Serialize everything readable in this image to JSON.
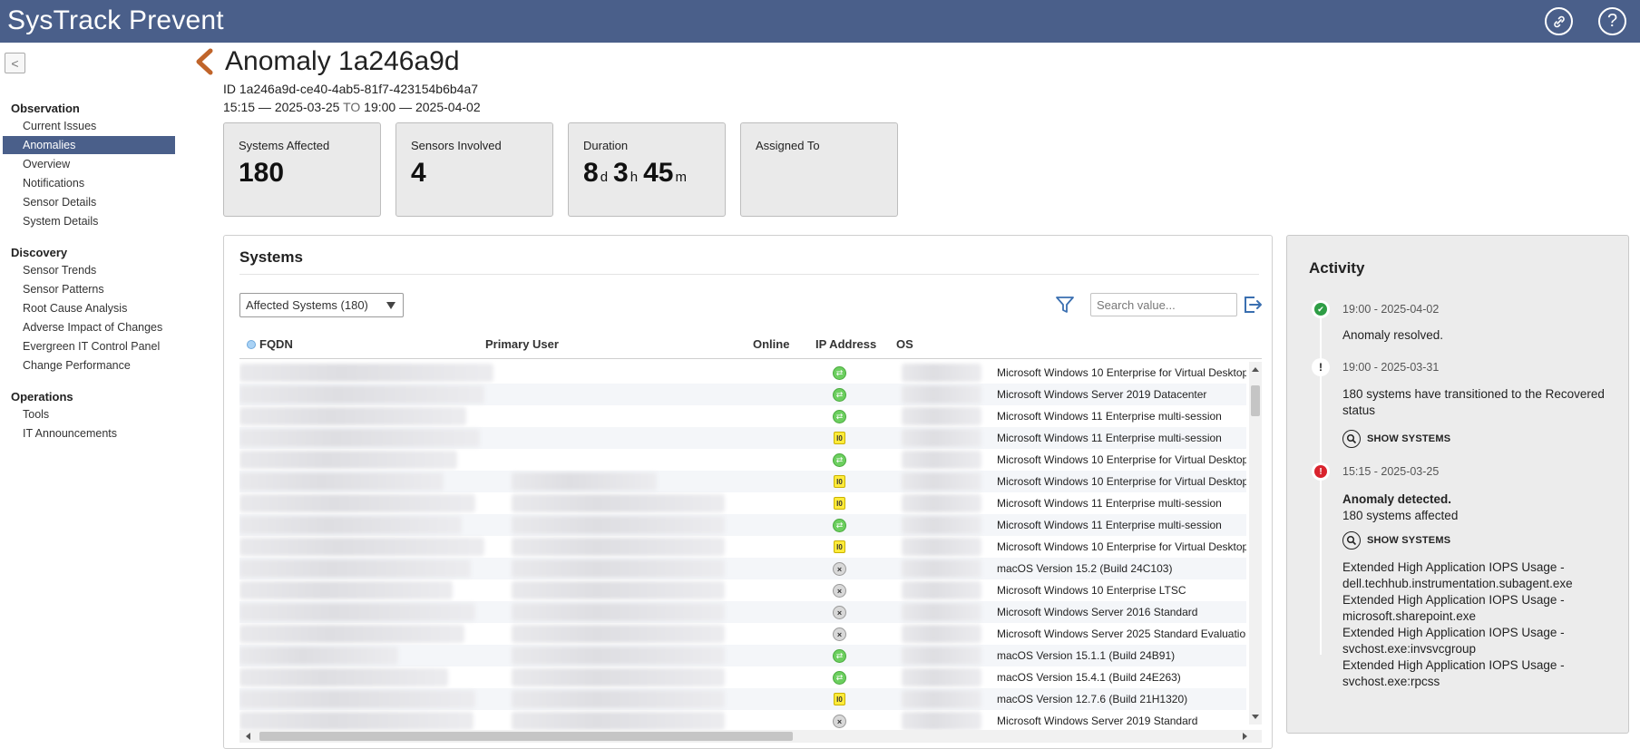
{
  "header": {
    "app_title": "SysTrack Prevent",
    "link_icon": "link-icon",
    "help_label": "?"
  },
  "sidebar": {
    "collapse_glyph": "<",
    "sections": [
      {
        "title": "Observation",
        "items": [
          "Current Issues",
          "Anomalies",
          "Overview",
          "Notifications",
          "Sensor Details",
          "System Details"
        ]
      },
      {
        "title": "Discovery",
        "items": [
          "Sensor Trends",
          "Sensor Patterns",
          "Root Cause Analysis",
          "Adverse Impact of Changes",
          "Evergreen IT Control Panel",
          "Change Performance"
        ]
      },
      {
        "title": "Operations",
        "items": [
          "Tools",
          "IT Announcements"
        ]
      }
    ],
    "active_item": "Anomalies"
  },
  "anomaly": {
    "title": "Anomaly 1a246a9d",
    "id_text": "ID 1a246a9d-ce40-4ab5-81f7-423154b6b4a7",
    "start": "15:15 — 2025-03-25",
    "to_label": "TO",
    "end": "19:00 — 2025-04-02"
  },
  "cards": {
    "systems_affected": {
      "label": "Systems Affected",
      "value": "180"
    },
    "sensors_involved": {
      "label": "Sensors Involved",
      "value": "4"
    },
    "duration": {
      "label": "Duration",
      "days": "8",
      "days_unit": "d",
      "hours": "3",
      "hours_unit": "h",
      "minutes": "45",
      "minutes_unit": "m"
    },
    "assigned_to": {
      "label": "Assigned To",
      "value": ""
    }
  },
  "systems": {
    "title": "Systems",
    "filter_select": "Affected Systems (180)",
    "search_placeholder": "Search value...",
    "columns": {
      "fqdn": "FQDN",
      "primary_user": "Primary User",
      "online": "Online",
      "ip_address": "IP Address",
      "os": "OS"
    },
    "rows": [
      {
        "status": "online",
        "os": "Microsoft Windows 10 Enterprise for Virtual Desktops",
        "user_hidden": false
      },
      {
        "status": "online",
        "os": "Microsoft Windows Server 2019 Datacenter",
        "user_hidden": false
      },
      {
        "status": "online",
        "os": "Microsoft Windows 11 Enterprise multi-session",
        "user_hidden": false
      },
      {
        "status": "ready",
        "os": "Microsoft Windows 11 Enterprise multi-session",
        "user_hidden": false
      },
      {
        "status": "online",
        "os": "Microsoft Windows 10 Enterprise for Virtual Desktops",
        "user_hidden": false
      },
      {
        "status": "ready",
        "os": "Microsoft Windows 10 Enterprise for Virtual Desktops",
        "user_hidden": true
      },
      {
        "status": "ready",
        "os": "Microsoft Windows 11 Enterprise multi-session",
        "user_hidden": true
      },
      {
        "status": "online",
        "os": "Microsoft Windows 11 Enterprise multi-session",
        "user_hidden": true
      },
      {
        "status": "ready",
        "os": "Microsoft Windows 10 Enterprise for Virtual Desktops",
        "user_hidden": true
      },
      {
        "status": "offline",
        "os": "macOS Version 15.2 (Build 24C103)",
        "user_hidden": true
      },
      {
        "status": "offline",
        "os": "Microsoft Windows 10 Enterprise LTSC",
        "user_hidden": true
      },
      {
        "status": "offline",
        "os": "Microsoft Windows Server 2016 Standard",
        "user_hidden": true
      },
      {
        "status": "offline",
        "os": "Microsoft Windows Server 2025 Standard Evaluation",
        "user_hidden": true
      },
      {
        "status": "online",
        "os": "macOS Version 15.1.1 (Build 24B91)",
        "user_hidden": true
      },
      {
        "status": "online",
        "os": "macOS Version 15.4.1 (Build 24E263)",
        "user_hidden": true
      },
      {
        "status": "ready",
        "os": "macOS Version 12.7.6 (Build 21H1320)",
        "user_hidden": true
      },
      {
        "status": "offline",
        "os": "Microsoft Windows Server 2019 Standard",
        "user_hidden": true
      }
    ]
  },
  "activity": {
    "title": "Activity",
    "events": [
      {
        "type": "resolved",
        "time": "19:00 - 2025-04-02",
        "text": "Anomaly resolved."
      },
      {
        "type": "warning",
        "time": "19:00 - 2025-03-31",
        "text": "180 systems have transitioned to the Recovered status",
        "button": "SHOW SYSTEMS"
      },
      {
        "type": "detected",
        "time": "15:15 - 2025-03-25",
        "heading": "Anomaly detected.",
        "text": "180 systems affected",
        "button": "SHOW SYSTEMS",
        "sensors": [
          "Extended High Application IOPS Usage - dell.techhub.instrumentation.subagent.exe",
          "Extended High Application IOPS Usage - microsoft.sharepoint.exe",
          "Extended High Application IOPS Usage - svchost.exe:invsvcgroup",
          "Extended High Application IOPS Usage - svchost.exe:rpcss"
        ]
      }
    ]
  },
  "colors": {
    "header_bg": "#4a5f8a",
    "accent_back": "#c0642a",
    "online": "#6ccf5f",
    "detected": "#d9232d",
    "resolved": "#2e9d45"
  }
}
